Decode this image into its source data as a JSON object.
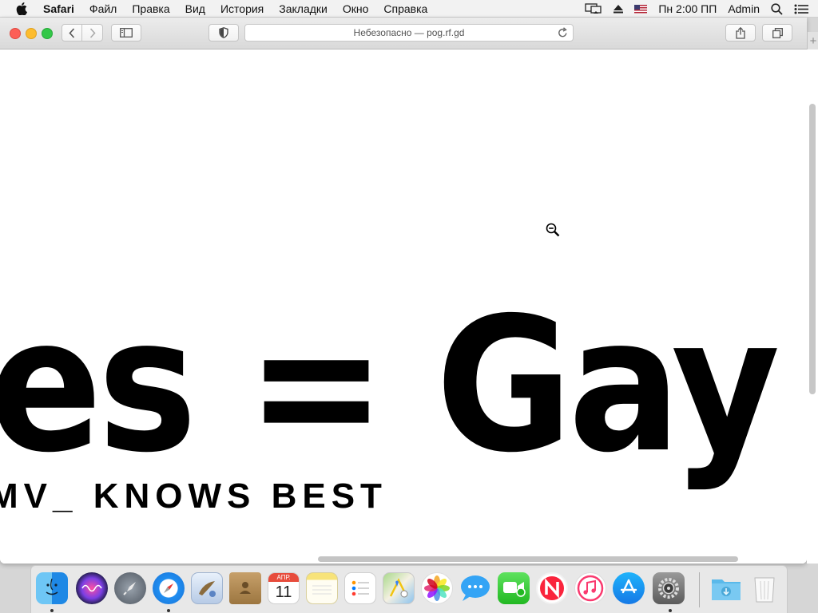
{
  "menubar": {
    "app_name": "Safari",
    "items": [
      "Файл",
      "Правка",
      "Вид",
      "История",
      "Закладки",
      "Окно",
      "Справка"
    ],
    "clock": "Пн 2:00 ПП",
    "user": "Admin"
  },
  "browser": {
    "address_text": "Небезопасно — pog.rf.gd",
    "new_tab_symbol": "+"
  },
  "page": {
    "headline": "ies = Gay",
    "subline": "MV_ KNOWS BEST"
  },
  "dock": {
    "calendar_month": "АПР.",
    "calendar_day": "11",
    "apps": [
      "finder",
      "siri",
      "launchpad",
      "safari",
      "mail",
      "contacts",
      "calendar",
      "notes",
      "reminders",
      "maps",
      "photos",
      "messages",
      "facetime",
      "news",
      "itunes",
      "app-store",
      "system-preferences",
      "downloads",
      "trash"
    ]
  },
  "colors": {
    "close": "#fc5f57",
    "minimize": "#fdbc2e",
    "maximize": "#33c748"
  }
}
